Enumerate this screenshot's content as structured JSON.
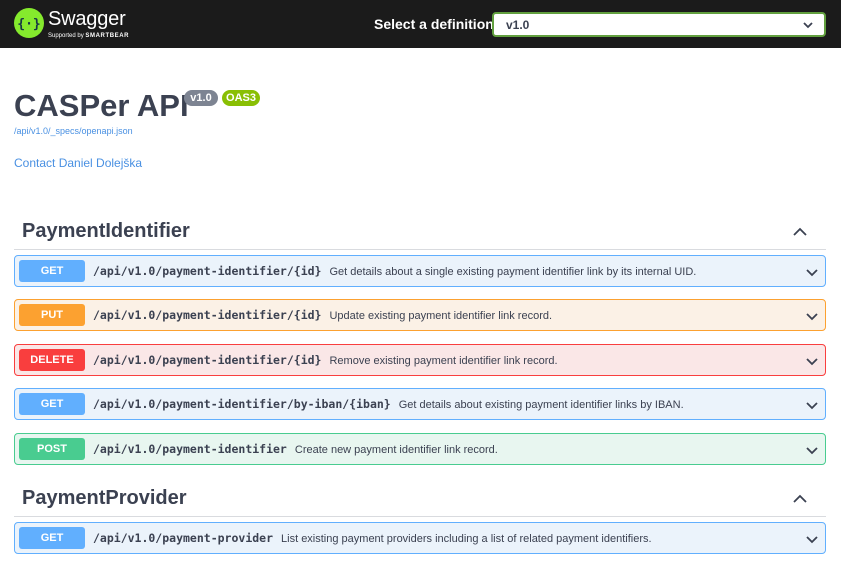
{
  "topbar": {
    "brand": "Swagger",
    "brand_sub_prefix": "Supported by",
    "brand_sub_name": "SMARTBEAR",
    "select_label": "Select a definition",
    "select_value": "v1.0"
  },
  "info": {
    "title": "CASPer API",
    "version_badge": "v1.0",
    "oas_badge": "OAS3",
    "spec_url": "/api/v1.0/_specs/openapi.json",
    "contact": "Contact Daniel Dolejška"
  },
  "sections": [
    {
      "name": "PaymentIdentifier",
      "operations": [
        {
          "method": "GET",
          "path": "/api/v1.0/payment-identifier/{id}",
          "summary": "Get details about a single existing payment identifier link by its internal UID."
        },
        {
          "method": "PUT",
          "path": "/api/v1.0/payment-identifier/{id}",
          "summary": "Update existing payment identifier link record."
        },
        {
          "method": "DELETE",
          "path": "/api/v1.0/payment-identifier/{id}",
          "summary": "Remove existing payment identifier link record."
        },
        {
          "method": "GET",
          "path": "/api/v1.0/payment-identifier/by-iban/{iban}",
          "summary": "Get details about existing payment identifier links by IBAN."
        },
        {
          "method": "POST",
          "path": "/api/v1.0/payment-identifier",
          "summary": "Create new payment identifier link record."
        }
      ]
    },
    {
      "name": "PaymentProvider",
      "operations": [
        {
          "method": "GET",
          "path": "/api/v1.0/payment-provider",
          "summary": "List existing payment providers including a list of related payment identifiers."
        }
      ]
    }
  ],
  "colors": {
    "get": "#61affe",
    "put": "#fca130",
    "delete": "#f93e3e",
    "post": "#49cc90",
    "topbar": "#1b1b1b",
    "logo": "#85ea2d",
    "link": "#4990e2"
  },
  "icons": {
    "logo": "swagger-logo-icon",
    "select": "chevron-down-icon",
    "section_toggle": "chevron-up-icon",
    "operation_toggle": "chevron-down-icon"
  }
}
